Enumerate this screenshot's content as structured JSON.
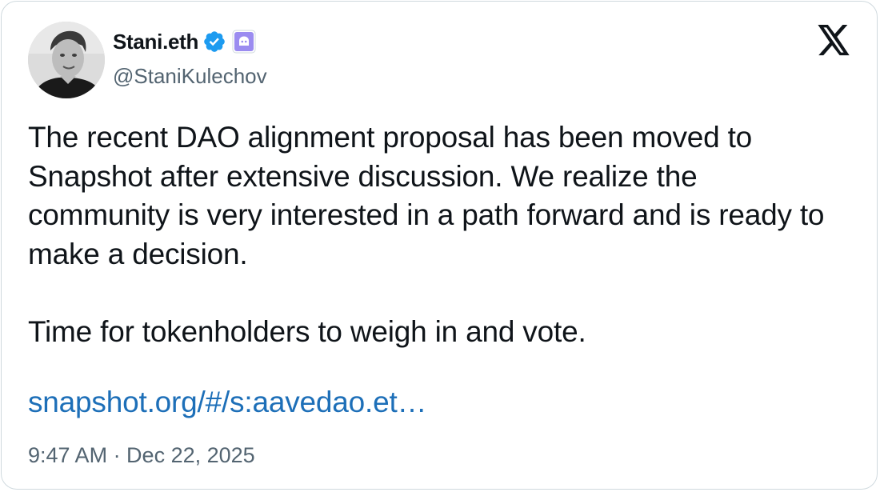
{
  "author": {
    "display_name": "Stani.eth",
    "handle": "@StaniKulechov",
    "verified_icon": "verified-badge-icon",
    "affiliate_icon": "ghost-affiliate-badge-icon"
  },
  "tweet": {
    "paragraph_1": "The recent DAO alignment proposal has been moved to Snapshot after extensive discussion. We realize the community is very interested in a path forward and is ready to make a decision.",
    "paragraph_2": "Time for tokenholders to weigh in and vote.",
    "link_text": "snapshot.org/#/s:aavedao.et…",
    "timestamp": "9:47 AM · Dec 22, 2025"
  },
  "icons": {
    "platform_logo": "x-logo-icon"
  },
  "colors": {
    "verified_blue": "#1d9bf0",
    "affiliate_purple": "#9b8cf0",
    "link_blue": "#1d6fb8",
    "secondary_text": "#536471",
    "primary_text": "#0f1419"
  }
}
